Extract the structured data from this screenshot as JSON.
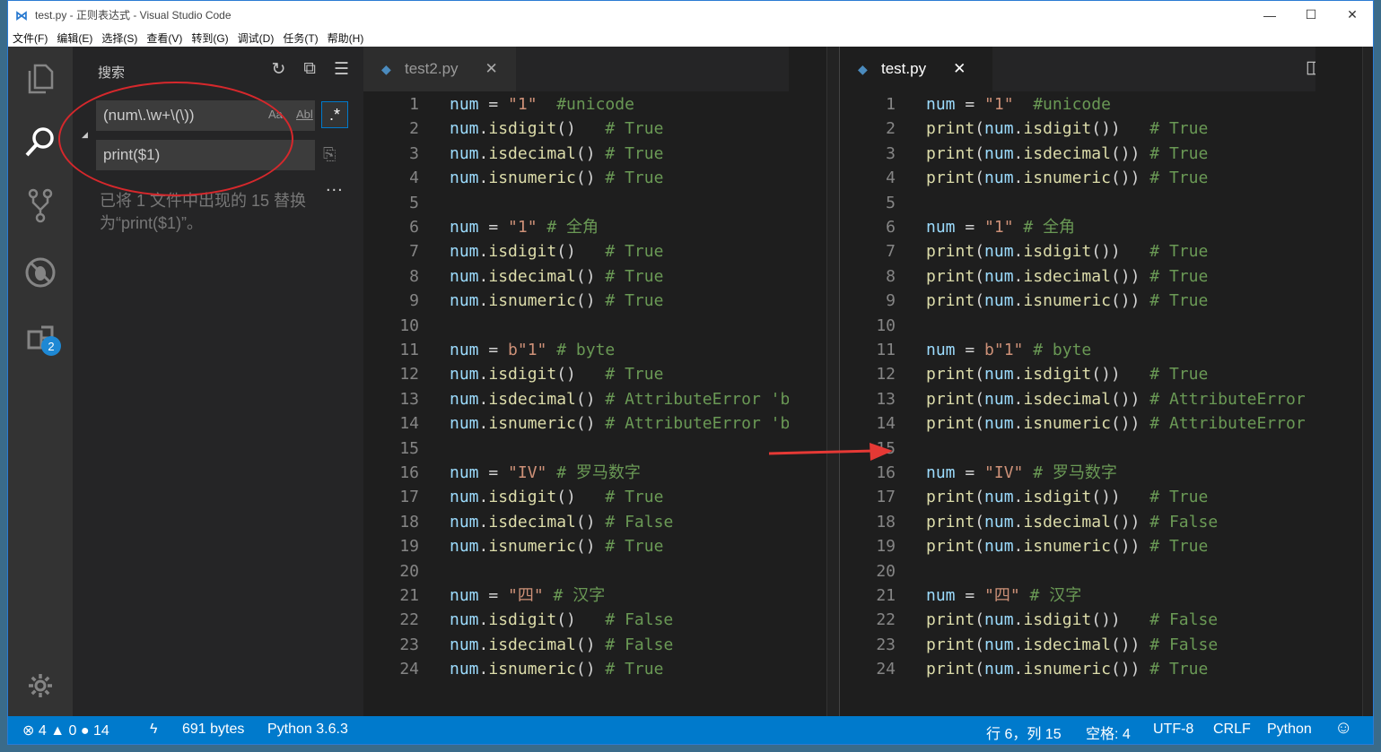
{
  "window": {
    "title": "test.py - 正则表达式 - Visual Studio Code",
    "minimize": "—",
    "maximize": "☐",
    "close": "✕"
  },
  "menu": [
    "文件(F)",
    "编辑(E)",
    "选择(S)",
    "查看(V)",
    "转到(G)",
    "调试(D)",
    "任务(T)",
    "帮助(H)"
  ],
  "activity": {
    "extensions_badge": "2"
  },
  "sidebar": {
    "title": "搜索",
    "search_value": "(num\\.\\w+\\(\\))",
    "match_case": "Aa",
    "whole_word": "Abl",
    "regex": ".*",
    "replace_value": "print($1)",
    "more": "...",
    "result_text": "已将 1 文件中出现的 15 替换为“print($1)”。"
  },
  "left_editor": {
    "tab_label": "test2.py",
    "tab_close": "✕",
    "line_numbers": [
      "1",
      "2",
      "3",
      "4",
      "5",
      "6",
      "7",
      "8",
      "9",
      "10",
      "11",
      "12",
      "13",
      "14",
      "15",
      "16",
      "17",
      "18",
      "19",
      "20",
      "21",
      "22",
      "23",
      "24"
    ],
    "lines": [
      [
        [
          "num",
          "var"
        ],
        [
          " = ",
          "plain"
        ],
        [
          "\"1\"",
          "str"
        ],
        [
          "  #unicode",
          "cmt"
        ]
      ],
      [
        [
          "num",
          "var"
        ],
        [
          ".",
          "plain"
        ],
        [
          "isdigit",
          "fn"
        ],
        [
          "()   ",
          "plain"
        ],
        [
          "# True",
          "cmt"
        ]
      ],
      [
        [
          "num",
          "var"
        ],
        [
          ".",
          "plain"
        ],
        [
          "isdecimal",
          "fn"
        ],
        [
          "() ",
          "plain"
        ],
        [
          "# True",
          "cmt"
        ]
      ],
      [
        [
          "num",
          "var"
        ],
        [
          ".",
          "plain"
        ],
        [
          "isnumeric",
          "fn"
        ],
        [
          "() ",
          "plain"
        ],
        [
          "# True",
          "cmt"
        ]
      ],
      [],
      [
        [
          "num",
          "var"
        ],
        [
          " = ",
          "plain"
        ],
        [
          "\"1\"",
          "str"
        ],
        [
          " # 全角",
          "cmt"
        ]
      ],
      [
        [
          "num",
          "var"
        ],
        [
          ".",
          "plain"
        ],
        [
          "isdigit",
          "fn"
        ],
        [
          "()   ",
          "plain"
        ],
        [
          "# True",
          "cmt"
        ]
      ],
      [
        [
          "num",
          "var"
        ],
        [
          ".",
          "plain"
        ],
        [
          "isdecimal",
          "fn"
        ],
        [
          "() ",
          "plain"
        ],
        [
          "# True",
          "cmt"
        ]
      ],
      [
        [
          "num",
          "var"
        ],
        [
          ".",
          "plain"
        ],
        [
          "isnumeric",
          "fn"
        ],
        [
          "() ",
          "plain"
        ],
        [
          "# True",
          "cmt"
        ]
      ],
      [],
      [
        [
          "num",
          "var"
        ],
        [
          " = ",
          "plain"
        ],
        [
          "b\"1\"",
          "str"
        ],
        [
          " # byte",
          "cmt"
        ]
      ],
      [
        [
          "num",
          "var"
        ],
        [
          ".",
          "plain"
        ],
        [
          "isdigit",
          "fn"
        ],
        [
          "()   ",
          "plain"
        ],
        [
          "# True",
          "cmt"
        ]
      ],
      [
        [
          "num",
          "var"
        ],
        [
          ".",
          "plain"
        ],
        [
          "isdecimal",
          "fn"
        ],
        [
          "() ",
          "plain"
        ],
        [
          "# AttributeError 'b",
          "cmt"
        ]
      ],
      [
        [
          "num",
          "var"
        ],
        [
          ".",
          "plain"
        ],
        [
          "isnumeric",
          "fn"
        ],
        [
          "() ",
          "plain"
        ],
        [
          "# AttributeError 'b",
          "cmt"
        ]
      ],
      [],
      [
        [
          "num",
          "var"
        ],
        [
          " = ",
          "plain"
        ],
        [
          "\"IV\"",
          "str"
        ],
        [
          " # 罗马数字",
          "cmt"
        ]
      ],
      [
        [
          "num",
          "var"
        ],
        [
          ".",
          "plain"
        ],
        [
          "isdigit",
          "fn"
        ],
        [
          "()   ",
          "plain"
        ],
        [
          "# True",
          "cmt"
        ]
      ],
      [
        [
          "num",
          "var"
        ],
        [
          ".",
          "plain"
        ],
        [
          "isdecimal",
          "fn"
        ],
        [
          "() ",
          "plain"
        ],
        [
          "# False",
          "cmt"
        ]
      ],
      [
        [
          "num",
          "var"
        ],
        [
          ".",
          "plain"
        ],
        [
          "isnumeric",
          "fn"
        ],
        [
          "() ",
          "plain"
        ],
        [
          "# True",
          "cmt"
        ]
      ],
      [],
      [
        [
          "num",
          "var"
        ],
        [
          " = ",
          "plain"
        ],
        [
          "\"四\"",
          "str"
        ],
        [
          " # 汉字",
          "cmt"
        ]
      ],
      [
        [
          "num",
          "var"
        ],
        [
          ".",
          "plain"
        ],
        [
          "isdigit",
          "fn"
        ],
        [
          "()   ",
          "plain"
        ],
        [
          "# False",
          "cmt"
        ]
      ],
      [
        [
          "num",
          "var"
        ],
        [
          ".",
          "plain"
        ],
        [
          "isdecimal",
          "fn"
        ],
        [
          "() ",
          "plain"
        ],
        [
          "# False",
          "cmt"
        ]
      ],
      [
        [
          "num",
          "var"
        ],
        [
          ".",
          "plain"
        ],
        [
          "isnumeric",
          "fn"
        ],
        [
          "() ",
          "plain"
        ],
        [
          "# True",
          "cmt"
        ]
      ]
    ]
  },
  "right_editor": {
    "tab_label": "test.py",
    "tab_close": "✕",
    "line_numbers": [
      "1",
      "2",
      "3",
      "4",
      "5",
      "6",
      "7",
      "8",
      "9",
      "10",
      "11",
      "12",
      "13",
      "14",
      "15",
      "16",
      "17",
      "18",
      "19",
      "20",
      "21",
      "22",
      "23",
      "24"
    ],
    "lines": [
      [
        [
          "num",
          "var"
        ],
        [
          " = ",
          "plain"
        ],
        [
          "\"1\"",
          "str"
        ],
        [
          "  #unicode",
          "cmt"
        ]
      ],
      [
        [
          "print",
          "fn"
        ],
        [
          "(",
          "plain"
        ],
        [
          "num",
          "var"
        ],
        [
          ".",
          "plain"
        ],
        [
          "isdigit",
          "fn"
        ],
        [
          "())   ",
          "plain"
        ],
        [
          "# True",
          "cmt"
        ]
      ],
      [
        [
          "print",
          "fn"
        ],
        [
          "(",
          "plain"
        ],
        [
          "num",
          "var"
        ],
        [
          ".",
          "plain"
        ],
        [
          "isdecimal",
          "fn"
        ],
        [
          "()) ",
          "plain"
        ],
        [
          "# True",
          "cmt"
        ]
      ],
      [
        [
          "print",
          "fn"
        ],
        [
          "(",
          "plain"
        ],
        [
          "num",
          "var"
        ],
        [
          ".",
          "plain"
        ],
        [
          "isnumeric",
          "fn"
        ],
        [
          "()) ",
          "plain"
        ],
        [
          "# True",
          "cmt"
        ]
      ],
      [],
      [
        [
          "num",
          "var"
        ],
        [
          " = ",
          "plain"
        ],
        [
          "\"1\"",
          "str"
        ],
        [
          " # 全角",
          "cmt"
        ]
      ],
      [
        [
          "print",
          "fn"
        ],
        [
          "(",
          "plain"
        ],
        [
          "num",
          "var"
        ],
        [
          ".",
          "plain"
        ],
        [
          "isdigit",
          "fn"
        ],
        [
          "())   ",
          "plain"
        ],
        [
          "# True",
          "cmt"
        ]
      ],
      [
        [
          "print",
          "fn"
        ],
        [
          "(",
          "plain"
        ],
        [
          "num",
          "var"
        ],
        [
          ".",
          "plain"
        ],
        [
          "isdecimal",
          "fn"
        ],
        [
          "()) ",
          "plain"
        ],
        [
          "# True",
          "cmt"
        ]
      ],
      [
        [
          "print",
          "fn"
        ],
        [
          "(",
          "plain"
        ],
        [
          "num",
          "var"
        ],
        [
          ".",
          "plain"
        ],
        [
          "isnumeric",
          "fn"
        ],
        [
          "()) ",
          "plain"
        ],
        [
          "# True",
          "cmt"
        ]
      ],
      [],
      [
        [
          "num",
          "var"
        ],
        [
          " = ",
          "plain"
        ],
        [
          "b\"1\"",
          "str"
        ],
        [
          " # byte",
          "cmt"
        ]
      ],
      [
        [
          "print",
          "fn"
        ],
        [
          "(",
          "plain"
        ],
        [
          "num",
          "var"
        ],
        [
          ".",
          "plain"
        ],
        [
          "isdigit",
          "fn"
        ],
        [
          "())   ",
          "plain"
        ],
        [
          "# True",
          "cmt"
        ]
      ],
      [
        [
          "print",
          "fn"
        ],
        [
          "(",
          "plain"
        ],
        [
          "num",
          "var"
        ],
        [
          ".",
          "plain"
        ],
        [
          "isdecimal",
          "fn"
        ],
        [
          "()) ",
          "plain"
        ],
        [
          "# AttributeError",
          "cmt"
        ]
      ],
      [
        [
          "print",
          "fn"
        ],
        [
          "(",
          "plain"
        ],
        [
          "num",
          "var"
        ],
        [
          ".",
          "plain"
        ],
        [
          "isnumeric",
          "fn"
        ],
        [
          "()) ",
          "plain"
        ],
        [
          "# AttributeError",
          "cmt"
        ]
      ],
      [],
      [
        [
          "num",
          "var"
        ],
        [
          " = ",
          "plain"
        ],
        [
          "\"IV\"",
          "str"
        ],
        [
          " # 罗马数字",
          "cmt"
        ]
      ],
      [
        [
          "print",
          "fn"
        ],
        [
          "(",
          "plain"
        ],
        [
          "num",
          "var"
        ],
        [
          ".",
          "plain"
        ],
        [
          "isdigit",
          "fn"
        ],
        [
          "())   ",
          "plain"
        ],
        [
          "# True",
          "cmt"
        ]
      ],
      [
        [
          "print",
          "fn"
        ],
        [
          "(",
          "plain"
        ],
        [
          "num",
          "var"
        ],
        [
          ".",
          "plain"
        ],
        [
          "isdecimal",
          "fn"
        ],
        [
          "()) ",
          "plain"
        ],
        [
          "# False",
          "cmt"
        ]
      ],
      [
        [
          "print",
          "fn"
        ],
        [
          "(",
          "plain"
        ],
        [
          "num",
          "var"
        ],
        [
          ".",
          "plain"
        ],
        [
          "isnumeric",
          "fn"
        ],
        [
          "()) ",
          "plain"
        ],
        [
          "# True",
          "cmt"
        ]
      ],
      [],
      [
        [
          "num",
          "var"
        ],
        [
          " = ",
          "plain"
        ],
        [
          "\"四\"",
          "str"
        ],
        [
          " # 汉字",
          "cmt"
        ]
      ],
      [
        [
          "print",
          "fn"
        ],
        [
          "(",
          "plain"
        ],
        [
          "num",
          "var"
        ],
        [
          ".",
          "plain"
        ],
        [
          "isdigit",
          "fn"
        ],
        [
          "())   ",
          "plain"
        ],
        [
          "# False",
          "cmt"
        ]
      ],
      [
        [
          "print",
          "fn"
        ],
        [
          "(",
          "plain"
        ],
        [
          "num",
          "var"
        ],
        [
          ".",
          "plain"
        ],
        [
          "isdecimal",
          "fn"
        ],
        [
          "()) ",
          "plain"
        ],
        [
          "# False",
          "cmt"
        ]
      ],
      [
        [
          "print",
          "fn"
        ],
        [
          "(",
          "plain"
        ],
        [
          "num",
          "var"
        ],
        [
          ".",
          "plain"
        ],
        [
          "isnumeric",
          "fn"
        ],
        [
          "()) ",
          "plain"
        ],
        [
          "# True",
          "cmt"
        ]
      ]
    ]
  },
  "status": {
    "errors": "4",
    "warnings": "0",
    "infos": "14",
    "bytes": "691 bytes",
    "interpreter": "Python 3.6.3",
    "position": "行 6，列 15",
    "spaces": "空格: 4",
    "encoding": "UTF-8",
    "eol": "CRLF",
    "language": "Python"
  },
  "colors": {
    "accent": "#007acc",
    "annotation_red": "#d6282c",
    "variable": "#9cdcfe",
    "string": "#ce9178",
    "comment": "#6a9955",
    "function": "#dcdcaa"
  }
}
